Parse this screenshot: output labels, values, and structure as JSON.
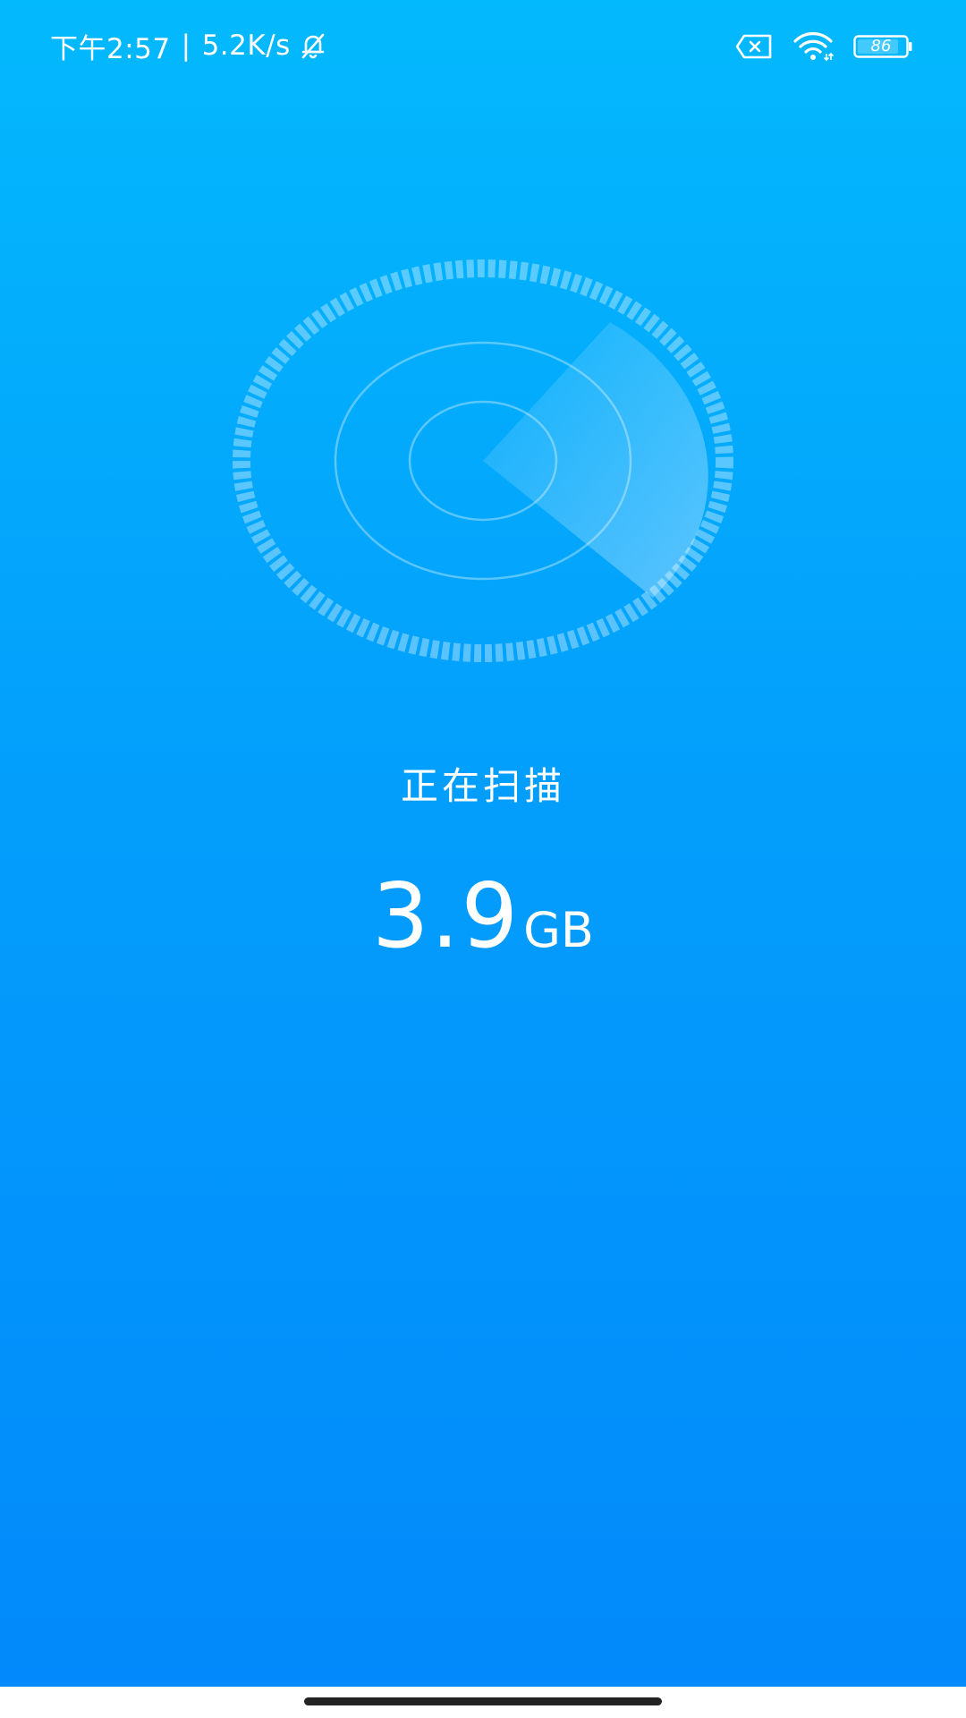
{
  "status_bar": {
    "time": "下午2:57",
    "separator": "|",
    "network_speed": "5.2K/s",
    "battery_level": "86",
    "icons": [
      "mute-bell-icon",
      "sim-missing-icon",
      "wifi-icon",
      "battery-icon"
    ]
  },
  "scanner": {
    "status_text": "正在扫描",
    "size_value": "3.9",
    "size_unit": "GB"
  },
  "colors": {
    "gradient_top": "#03b9fd",
    "gradient_bottom": "#0289fb",
    "text": "#ffffff"
  }
}
